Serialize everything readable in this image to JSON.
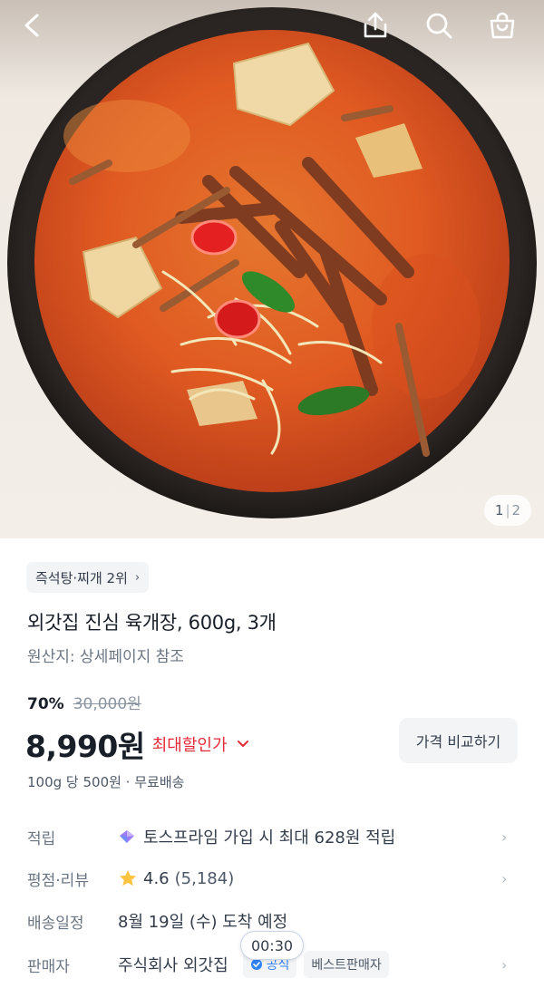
{
  "hero": {
    "pager": {
      "current": "1",
      "separator": "|",
      "total": "2"
    }
  },
  "topbar": {
    "icons": [
      "back-arrow-icon",
      "share-icon",
      "search-icon",
      "shopping-bag-icon"
    ]
  },
  "product": {
    "rank_chip": "즉석탕·찌개 2위",
    "title": "외갓집 진심 육개장, 600g, 3개",
    "origin": "원산지: 상세페이지 참조",
    "discount_rate": "70%",
    "original_price": "30,000원",
    "price": "8,990원",
    "best_price_label": "최대할인가",
    "compare_button": "가격 비교하기",
    "unit_info": "100g 당 500원 · 무료배송"
  },
  "rows": {
    "points": {
      "label": "적립",
      "value": "토스프라임 가입 시 최대 628원 적립"
    },
    "rating": {
      "label": "평점·리뷰",
      "score": "4.6",
      "count": "(5,184)"
    },
    "delivery": {
      "label": "배송일정",
      "value": "8월 19일 (수) 도착 예정"
    },
    "seller": {
      "label": "판매자",
      "value": "주식회사 외갓집",
      "badge_official": "공식",
      "badge_best": "베스트판매자"
    }
  },
  "overlay": {
    "timer": "00:30"
  },
  "colors": {
    "accent_red": "#e42939",
    "text_primary": "#191f28",
    "text_secondary": "#6b7684",
    "chip_bg": "#f2f4f6",
    "star": "#ffc342"
  }
}
